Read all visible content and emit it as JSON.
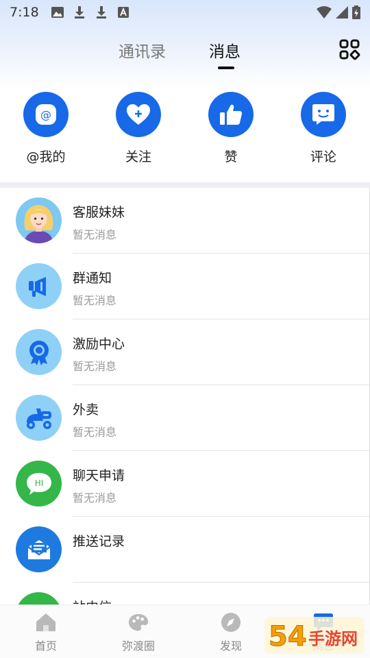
{
  "status_bar": {
    "time": "7:18"
  },
  "tabs": {
    "contacts": "通讯录",
    "messages": "消息"
  },
  "quick_actions": [
    {
      "label": "@我的",
      "icon": "at-icon"
    },
    {
      "label": "关注",
      "icon": "heart-plus-icon"
    },
    {
      "label": "赞",
      "icon": "thumbs-up-icon"
    },
    {
      "label": "评论",
      "icon": "smile-chat-icon"
    }
  ],
  "messages": [
    {
      "title": "客服妹妹",
      "subtitle": "暂无消息",
      "icon": "customer-service-avatar"
    },
    {
      "title": "群通知",
      "subtitle": "暂无消息",
      "icon": "megaphone-icon"
    },
    {
      "title": "激励中心",
      "subtitle": "暂无消息",
      "icon": "medal-icon"
    },
    {
      "title": "外卖",
      "subtitle": "暂无消息",
      "icon": "scooter-icon"
    },
    {
      "title": "聊天申请",
      "subtitle": "暂无消息",
      "icon": "hi-chat-icon"
    },
    {
      "title": "推送记录",
      "subtitle": "",
      "icon": "envelope-icon"
    },
    {
      "title": "站内信",
      "subtitle": "",
      "icon": "site-mail-icon"
    }
  ],
  "bottom_nav": [
    {
      "label": "首页",
      "icon": "home-icon"
    },
    {
      "label": "弥渡圈",
      "icon": "palette-icon"
    },
    {
      "label": "发现",
      "icon": "compass-icon"
    },
    {
      "label": "消息",
      "icon": "chat-icon"
    }
  ],
  "watermark": {
    "text": "54手游网"
  },
  "colors": {
    "accent": "#1769e8",
    "light_blue": "#8fd0f7",
    "green": "#34b649"
  }
}
